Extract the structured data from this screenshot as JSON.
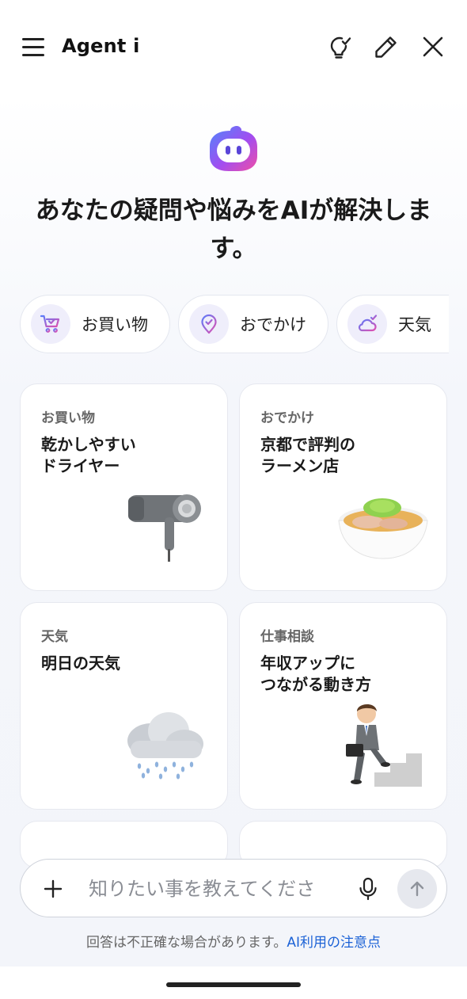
{
  "header": {
    "title": "Agent i",
    "icons": [
      "menu-icon",
      "lightbulb-check-icon",
      "edit-pencil-icon",
      "close-icon"
    ]
  },
  "hero": {
    "headline_line1": "あなたの疑問や悩みをAIが解決しま",
    "headline_line2": "す。"
  },
  "chips": [
    {
      "label": "お買い物",
      "icon": "shopping-cart-icon"
    },
    {
      "label": "おでかけ",
      "icon": "location-pin-icon"
    },
    {
      "label": "天気",
      "icon": "weather-cloud-icon"
    }
  ],
  "cards": [
    {
      "category": "お買い物",
      "title_line1": "乾かしやすい",
      "title_line2": "ドライヤー",
      "image": "hair-dryer-image"
    },
    {
      "category": "おでかけ",
      "title_line1": "京都で評判の",
      "title_line2": "ラーメン店",
      "image": "ramen-bowl-image"
    },
    {
      "category": "天気",
      "title_line1": "明日の天気",
      "title_line2": "",
      "image": "rain-cloud-image"
    },
    {
      "category": "仕事相談",
      "title_line1": "年収アップに",
      "title_line2": "つながる動き方",
      "image": "businessman-stairs-image"
    }
  ],
  "input": {
    "placeholder": "知りたい事を教えてくださ",
    "value": ""
  },
  "footer": {
    "disclaimer": "回答は不正確な場合があります。",
    "link": "AI利用の注意点"
  },
  "colors": {
    "accent_link": "#1c62d6",
    "logo_gradient": [
      "#5b7cfa",
      "#a24df0",
      "#ef4fa6"
    ]
  }
}
